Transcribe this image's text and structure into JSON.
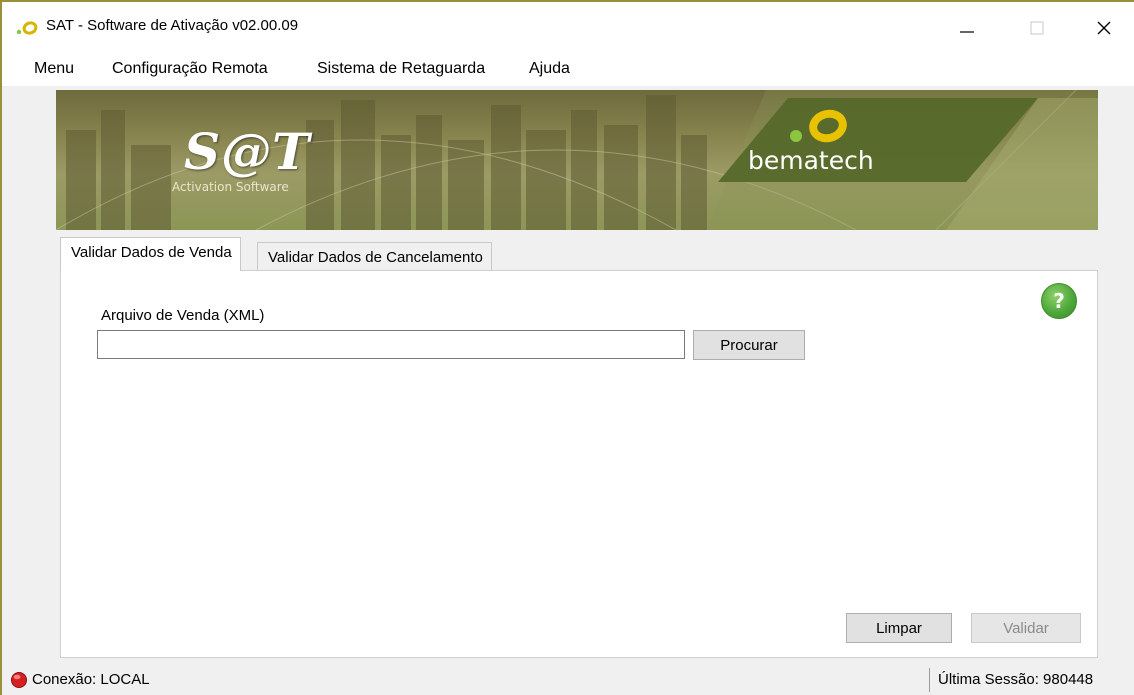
{
  "window": {
    "title": "SAT - Software de Ativação v02.00.09",
    "controls": {
      "minimize": "minimize-icon",
      "maximize": "maximize-icon",
      "close": "close-icon"
    }
  },
  "menu": {
    "items": [
      "Menu",
      "Configuração Remota",
      "Sistema de Retaguarda",
      "Ajuda"
    ]
  },
  "banner": {
    "product_logo": "S@T",
    "product_subtitle": "Activation Software",
    "brand": "bematech"
  },
  "tabs": [
    {
      "label": "Validar Dados de Venda",
      "active": true
    },
    {
      "label": "Validar Dados de Cancelamento",
      "active": false
    }
  ],
  "form": {
    "file_label": "Arquivo de Venda (XML)",
    "file_value": "",
    "browse_label": "Procurar",
    "clear_label": "Limpar",
    "validate_label": "Validar",
    "validate_enabled": false,
    "help_label": "?"
  },
  "status": {
    "connection": "Conexão: LOCAL",
    "connection_indicator_color": "#d42020",
    "last_session": "Última Sessão: 980448"
  },
  "colors": {
    "accent_green": "#4fa83a",
    "brand_panel": "#5a6a28",
    "window_border": "#9a8f3a"
  }
}
